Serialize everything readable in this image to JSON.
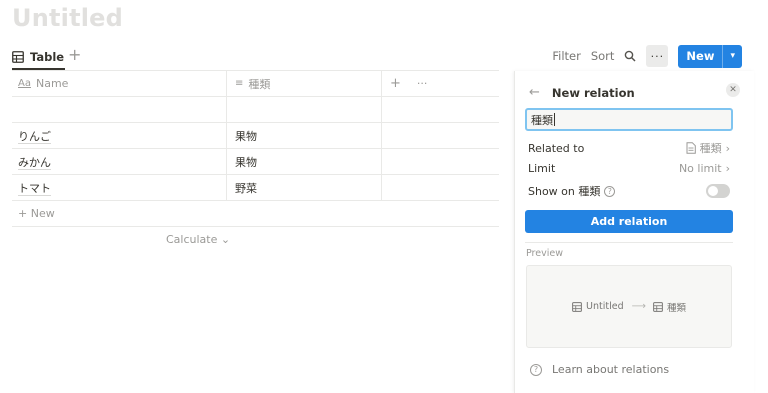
{
  "page": {
    "title": "Untitled"
  },
  "views": {
    "active_tab": "Table",
    "add_label": "+"
  },
  "toolbar": {
    "filter": "Filter",
    "sort": "Sort",
    "more": "···",
    "new": "New"
  },
  "table": {
    "headers": {
      "name": "Name",
      "name_icon": "Aa",
      "kind": "種類",
      "kind_icon": "≡",
      "add": "+",
      "more": "···"
    },
    "rows": [
      {
        "name": "",
        "kind": ""
      },
      {
        "name": "りんご",
        "kind": "果物"
      },
      {
        "name": "みかん",
        "kind": "果物"
      },
      {
        "name": "トマト",
        "kind": "野菜"
      }
    ],
    "new_row": "+ New",
    "calculate": "Calculate ⌄"
  },
  "panel": {
    "title": "New relation",
    "input_value": "種類",
    "related_to_label": "Related to",
    "related_to_value": "種類",
    "limit_label": "Limit",
    "limit_value": "No limit",
    "show_on_label": "Show on 種類",
    "add_button": "Add relation",
    "preview_label": "Preview",
    "preview_source": "Untitled",
    "preview_target": "種類",
    "learn_link": "Learn about relations"
  },
  "colors": {
    "accent": "#2383e2",
    "input_focus": "#7fc4f0",
    "title_placeholder": "#e1e0de"
  }
}
